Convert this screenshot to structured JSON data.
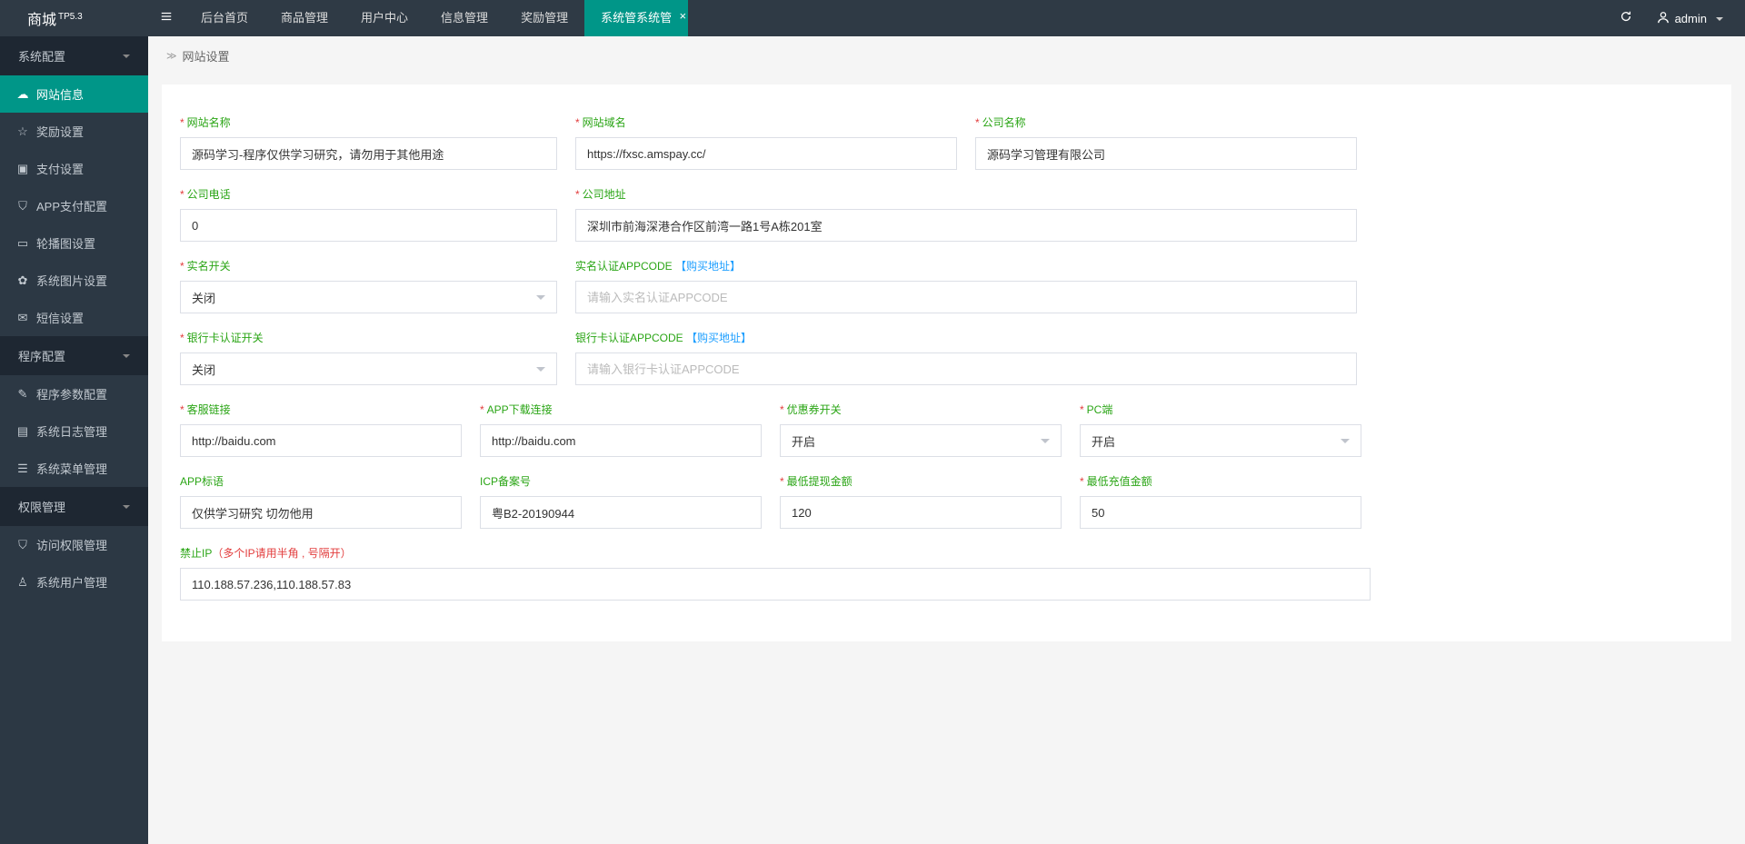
{
  "header": {
    "logo": "商城",
    "logo_badge": "TP5.3",
    "nav": [
      "后台首页",
      "商品管理",
      "用户中心",
      "信息管理",
      "奖励管理",
      "系统管系统管"
    ],
    "nav_active_index": 5,
    "user": "admin"
  },
  "sidebar": {
    "groups": [
      {
        "title": "系统配置",
        "items": [
          {
            "icon": "cloud",
            "label": "网站信息",
            "active": true
          },
          {
            "icon": "star",
            "label": "奖励设置"
          },
          {
            "icon": "money",
            "label": "支付设置"
          },
          {
            "icon": "shield",
            "label": "APP支付配置"
          },
          {
            "icon": "image",
            "label": "轮播图设置"
          },
          {
            "icon": "gear",
            "label": "系统图片设置"
          },
          {
            "icon": "chat",
            "label": "短信设置"
          }
        ]
      },
      {
        "title": "程序配置",
        "items": [
          {
            "icon": "link",
            "label": "程序参数配置"
          },
          {
            "icon": "doc",
            "label": "系统日志管理"
          },
          {
            "icon": "menu",
            "label": "系统菜单管理"
          }
        ]
      },
      {
        "title": "权限管理",
        "items": [
          {
            "icon": "shield",
            "label": "访问权限管理"
          },
          {
            "icon": "user",
            "label": "系统用户管理"
          }
        ]
      }
    ]
  },
  "breadcrumb": "网站设置",
  "form": {
    "site_name": {
      "label": "网站名称",
      "value": "源码学习-程序仅供学习研究，请勿用于其他用途",
      "required": true
    },
    "site_domain": {
      "label": "网站域名",
      "value": "https://fxsc.amspay.cc/",
      "required": true
    },
    "company_name": {
      "label": "公司名称",
      "value": "源码学习管理有限公司",
      "required": true
    },
    "company_phone": {
      "label": "公司电话",
      "value": "0",
      "required": true
    },
    "company_address": {
      "label": "公司地址",
      "value": "深圳市前海深港合作区前湾一路1号A栋201室",
      "required": true
    },
    "realname_switch": {
      "label": "实名开关",
      "value": "关闭",
      "required": true
    },
    "realname_appcode": {
      "label": "实名认证APPCODE",
      "link_text": "【购买地址】",
      "placeholder": "请输入实名认证APPCODE",
      "value": ""
    },
    "bankcard_switch": {
      "label": "银行卡认证开关",
      "value": "关闭",
      "required": true
    },
    "bankcard_appcode": {
      "label": "银行卡认证APPCODE",
      "link_text": "【购买地址】",
      "placeholder": "请输入银行卡认证APPCODE",
      "value": ""
    },
    "service_link": {
      "label": "客服链接",
      "value": "http://baidu.com",
      "required": true
    },
    "app_download": {
      "label": "APP下载连接",
      "value": "http://baidu.com",
      "required": true
    },
    "coupon_switch": {
      "label": "优惠券开关",
      "value": "开启",
      "required": true
    },
    "pc_side": {
      "label": "PC端",
      "value": "开启",
      "required": true
    },
    "app_slogan": {
      "label": "APP标语",
      "value": "仅供学习研究 切勿他用"
    },
    "icp": {
      "label": "ICP备案号",
      "value": "粤B2-20190944"
    },
    "min_withdraw": {
      "label": "最低提现金额",
      "value": "120",
      "required": true
    },
    "min_recharge": {
      "label": "最低充值金额",
      "value": "50",
      "required": true
    },
    "ban_ip": {
      "label": "禁止IP",
      "hint": "（多个IP请用半角 , 号隔开）",
      "value": "110.188.57.236,110.188.57.83"
    }
  }
}
